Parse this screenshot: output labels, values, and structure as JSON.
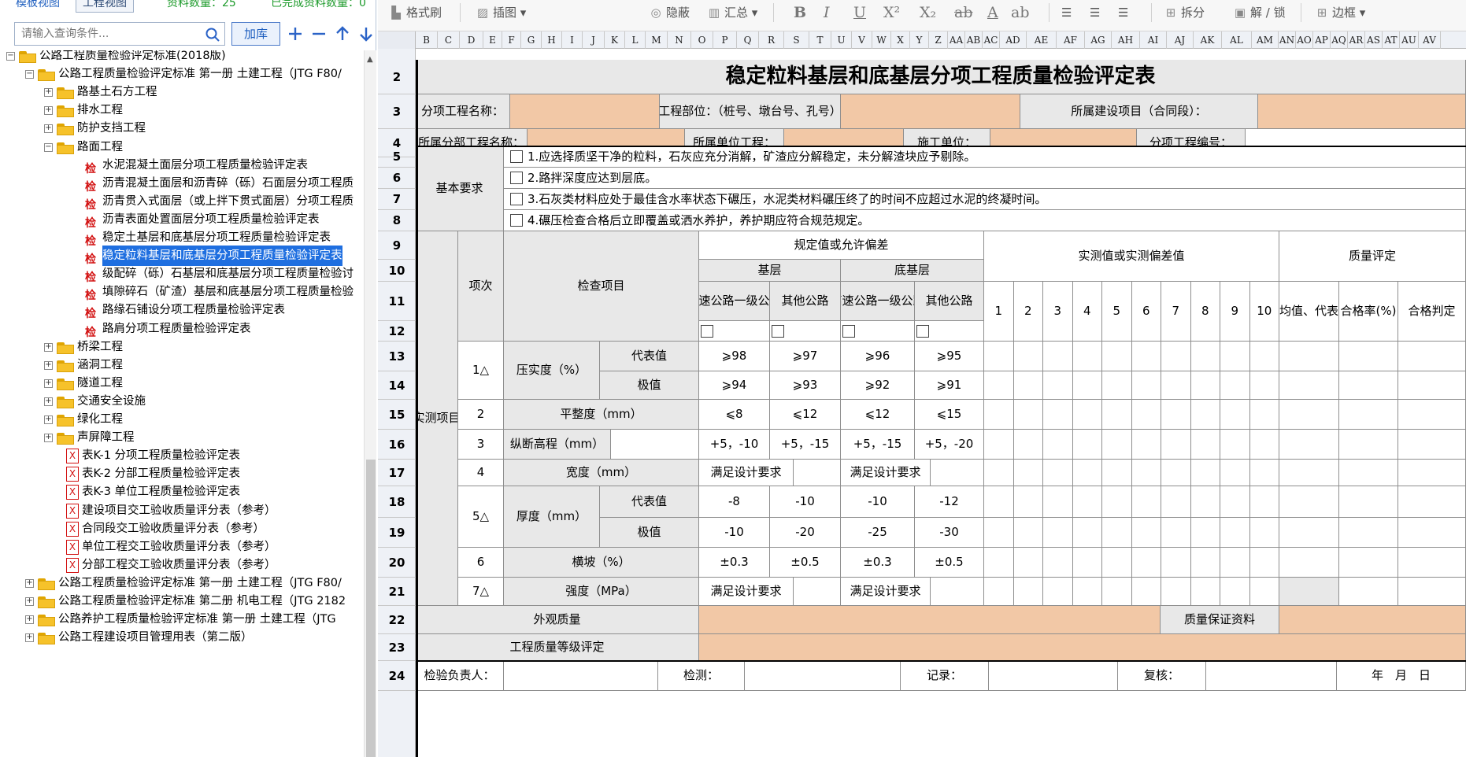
{
  "left_panel": {
    "tabs": [
      "模板视图",
      "工程视图"
    ],
    "data_count": "资料数量：25",
    "done_count": "已完成资料数量：0",
    "search_placeholder": "请输入查询条件...",
    "library_button": "加库",
    "tree": [
      {
        "level": 0,
        "kind": "folder",
        "expander": "-",
        "label": "公路工程质量检验评定标准(2018版)"
      },
      {
        "level": 1,
        "kind": "folder",
        "expander": "-",
        "label": "公路工程质量检验评定标准 第一册 土建工程（JTG F80/"
      },
      {
        "level": 2,
        "kind": "folder",
        "expander": "+",
        "label": "路基土石方工程"
      },
      {
        "level": 2,
        "kind": "folder",
        "expander": "+",
        "label": "排水工程"
      },
      {
        "level": 2,
        "kind": "folder",
        "expander": "+",
        "label": "防护支挡工程"
      },
      {
        "level": 2,
        "kind": "folder",
        "expander": "-",
        "label": "路面工程"
      },
      {
        "level": 3,
        "kind": "check",
        "label": "水泥混凝土面层分项工程质量检验评定表"
      },
      {
        "level": 3,
        "kind": "check",
        "label": "沥青混凝土面层和沥青碎（砾）石面层分项工程质"
      },
      {
        "level": 3,
        "kind": "check",
        "label": "沥青贯入式面层（或上拌下贯式面层）分项工程质"
      },
      {
        "level": 3,
        "kind": "check",
        "label": "沥青表面处置面层分项工程质量检验评定表"
      },
      {
        "level": 3,
        "kind": "check",
        "label": "稳定土基层和底基层分项工程质量检验评定表"
      },
      {
        "level": 3,
        "kind": "check",
        "label": "稳定粒料基层和底基层分项工程质量检验评定表",
        "selected": true
      },
      {
        "level": 3,
        "kind": "check",
        "label": "级配碎（砾）石基层和底基层分项工程质量检验讨"
      },
      {
        "level": 3,
        "kind": "check",
        "label": "填隙碎石（矿渣）基层和底基层分项工程质量检验"
      },
      {
        "level": 3,
        "kind": "check",
        "label": "路缘石铺设分项工程质量检验评定表"
      },
      {
        "level": 3,
        "kind": "check",
        "label": "路肩分项工程质量检验评定表"
      },
      {
        "level": 2,
        "kind": "folder",
        "expander": "+",
        "label": "桥梁工程"
      },
      {
        "level": 2,
        "kind": "folder",
        "expander": "+",
        "label": "涵洞工程"
      },
      {
        "level": 2,
        "kind": "folder",
        "expander": "+",
        "label": "隧道工程"
      },
      {
        "level": 2,
        "kind": "folder",
        "expander": "+",
        "label": "交通安全设施"
      },
      {
        "level": 2,
        "kind": "folder",
        "expander": "+",
        "label": "绿化工程"
      },
      {
        "level": 2,
        "kind": "folder",
        "expander": "+",
        "label": "声屏障工程"
      },
      {
        "level": 2,
        "kind": "xdoc",
        "label": "表K-1 分项工程质量检验评定表"
      },
      {
        "level": 2,
        "kind": "xdoc",
        "label": "表K-2 分部工程质量检验评定表"
      },
      {
        "level": 2,
        "kind": "xdoc",
        "label": "表K-3 单位工程质量检验评定表"
      },
      {
        "level": 2,
        "kind": "xdoc",
        "label": "建设项目交工验收质量评分表（参考）"
      },
      {
        "level": 2,
        "kind": "xdoc",
        "label": "合同段交工验收质量评分表（参考）"
      },
      {
        "level": 2,
        "kind": "xdoc",
        "label": "单位工程交工验收质量评分表（参考）"
      },
      {
        "level": 2,
        "kind": "xdoc",
        "label": "分部工程交工验收质量评分表（参考）"
      },
      {
        "level": 1,
        "kind": "folder",
        "expander": "+",
        "label": "公路工程质量检验评定标准 第一册 土建工程（JTG F80/"
      },
      {
        "level": 1,
        "kind": "folder",
        "expander": "+",
        "label": "公路工程质量检验评定标准 第二册 机电工程（JTG 2182"
      },
      {
        "level": 1,
        "kind": "folder",
        "expander": "+",
        "label": "公路养护工程质量检验评定标准 第一册 土建工程（JTG"
      },
      {
        "level": 1,
        "kind": "folder",
        "expander": "+",
        "label": "公路工程建设项目管理用表（第二版）"
      }
    ]
  },
  "toolbar": {
    "format_painter": "格式刷",
    "insert_image": "插图",
    "hide": "隐蔽",
    "summary": "汇总",
    "bold": "B",
    "italic": "I",
    "underline": "U",
    "superscript": "X²",
    "subscript": "X₂",
    "strike": "ab",
    "font_color": "A",
    "phonetic": "ab",
    "split": "拆分",
    "unlock": "解 / 锁",
    "border": "边框"
  },
  "columns": [
    "B",
    "C",
    "D",
    "E",
    "F",
    "G",
    "H",
    "I",
    "J",
    "K",
    "L",
    "M",
    "N",
    "O",
    "P",
    "Q",
    "R",
    "S",
    "T",
    "U",
    "V",
    "W",
    "X",
    "Y",
    "Z",
    "AA",
    "AB",
    "AC",
    "AD",
    "AE",
    "AF",
    "AG",
    "AH",
    "AI",
    "AJ",
    "AK",
    "AL",
    "AM",
    "AN",
    "AO",
    "AP",
    "AQ",
    "AR",
    "AS",
    "AT",
    "AU",
    "AV"
  ],
  "rows": [
    "2",
    "3",
    "4",
    "5",
    "6",
    "7",
    "8",
    "9",
    "10",
    "11",
    "12",
    "13",
    "14",
    "15",
    "16",
    "17",
    "18",
    "19",
    "20",
    "21",
    "22",
    "23",
    "24"
  ],
  "form": {
    "title": "稳定粒料基层和底基层分项工程质量检验评定表",
    "r3": {
      "a": "分项工程名称：",
      "b": "工程部位：（桩号、墩台号、孔号）",
      "c": "所属建设项目（合同段）："
    },
    "r4": {
      "a": "所属分部工程名称：",
      "b": "所属单位工程：",
      "c": "施工单位：",
      "d": "分项工程编号："
    },
    "basic_req": "基本要求",
    "reqs": [
      "1.应选择质坚干净的粒料，石灰应充分消解，矿渣应分解稳定，未分解渣块应予剔除。",
      "2.路拌深度应达到层底。",
      "3.石灰类材料应处于最佳含水率状态下碾压，水泥类材料碾压终了的时间不应超过水泥的终凝时间。",
      "4.碾压检查合格后立即覆盖或洒水养护，养护期应符合规范规定。"
    ],
    "measured_items": "实测项目",
    "item_no": "项次",
    "check_item": "检查项目",
    "spec_header": "规定值或允许偏差",
    "base": "基层",
    "subbase": "底基层",
    "highway": "高速公路一级公路",
    "other": "其他公路",
    "measured_header": "实测值或实测偏差值",
    "quality_header": "质量评定",
    "avg": "平均值、代表值",
    "pass_rate": "合格率(%)",
    "judge": "合格判定",
    "nums": [
      "1",
      "2",
      "3",
      "4",
      "5",
      "6",
      "7",
      "8",
      "9",
      "10"
    ],
    "items": {
      "i1": "1△",
      "compaction": "压实度（%）",
      "rep": "代表值",
      "ext": "极值",
      "c_rep": [
        "⩾98",
        "⩾97",
        "⩾96",
        "⩾95"
      ],
      "c_ext": [
        "⩾94",
        "⩾93",
        "⩾92",
        "⩾91"
      ],
      "i2": "2",
      "flatness": "平整度（mm）",
      "f": [
        "⩽8",
        "⩽12",
        "⩽12",
        "⩽15"
      ],
      "i3": "3",
      "elev": "纵断高程（mm）",
      "e": [
        "+5，-10",
        "+5，-15",
        "+5，-15",
        "+5，-20"
      ],
      "i4": "4",
      "width": "宽度（mm）",
      "w1": "满足设计要求",
      "w2": "满足设计要求",
      "i5": "5△",
      "thick": "厚度（mm）",
      "t_rep": [
        "-8",
        "-10",
        "-10",
        "-12"
      ],
      "t_ext": [
        "-10",
        "-20",
        "-25",
        "-30"
      ],
      "i6": "6",
      "slope": "横坡（%）",
      "s": [
        "±0.3",
        "±0.5",
        "±0.3",
        "±0.5"
      ],
      "i7": "7△",
      "strength": "强度（MPa）",
      "st1": "满足设计要求",
      "st2": "满足设计要求"
    },
    "appearance": "外观质量",
    "assurance": "质量保证资料",
    "grade": "工程质量等级评定",
    "sign": {
      "a": "检验负责人：",
      "b": "检测：",
      "c": "记录：",
      "d": "复核：",
      "date": "年　月　日"
    }
  }
}
